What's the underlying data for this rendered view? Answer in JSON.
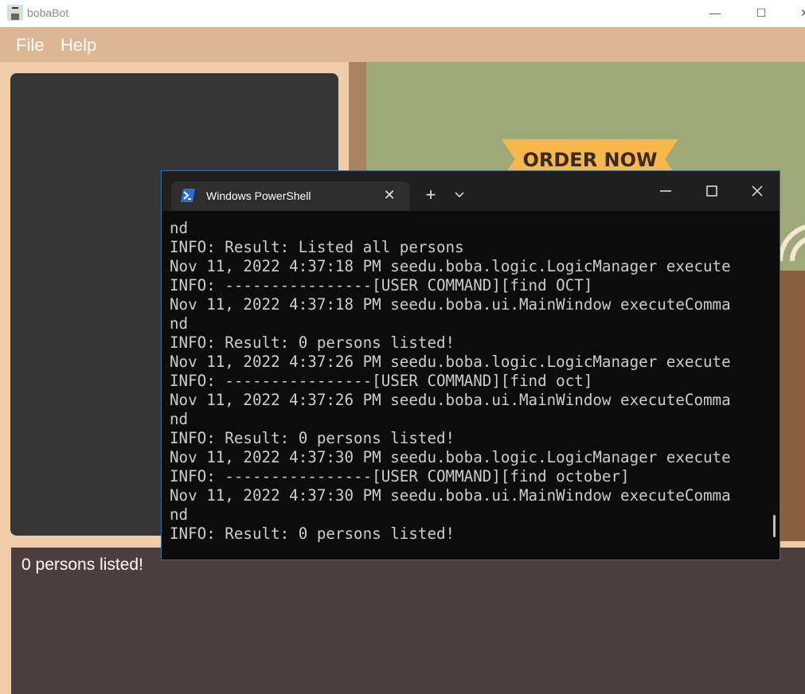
{
  "window": {
    "title": "bobaBot"
  },
  "menu": {
    "file": "File",
    "help": "Help"
  },
  "banner": {
    "order_text": "ORDER NOW"
  },
  "result": {
    "text": "0 persons listed!"
  },
  "powershell": {
    "tab_title": "Windows PowerShell",
    "lines": [
      "nd",
      "INFO: Result: Listed all persons",
      "Nov 11, 2022 4:37:18 PM seedu.boba.logic.LogicManager execute",
      "INFO: ----------------[USER COMMAND][find OCT]",
      "Nov 11, 2022 4:37:18 PM seedu.boba.ui.MainWindow executeComma",
      "nd",
      "INFO: Result: 0 persons listed!",
      "Nov 11, 2022 4:37:26 PM seedu.boba.logic.LogicManager execute",
      "INFO: ----------------[USER COMMAND][find oct]",
      "Nov 11, 2022 4:37:26 PM seedu.boba.ui.MainWindow executeComma",
      "nd",
      "INFO: Result: 0 persons listed!",
      "Nov 11, 2022 4:37:30 PM seedu.boba.logic.LogicManager execute",
      "INFO: ----------------[USER COMMAND][find october]",
      "Nov 11, 2022 4:37:30 PM seedu.boba.ui.MainWindow executeComma",
      "nd",
      "INFO: Result: 0 persons listed!"
    ]
  },
  "colors": {
    "menubar": "#ddb793",
    "left_panel": "#363636",
    "banner": "#9fa878",
    "result_box": "#4e3f3f",
    "terminal_bg": "#0c0c0c"
  }
}
